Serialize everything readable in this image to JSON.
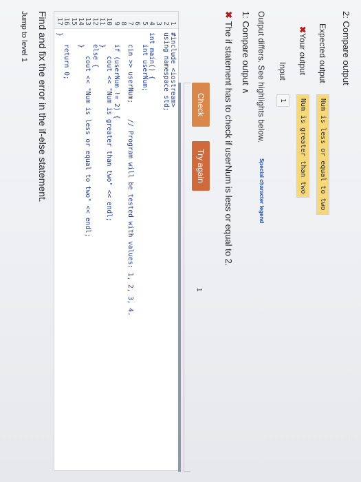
{
  "page": {
    "jump_link": "Jump to level 1",
    "instructions": "Find and fix the error in the if-else statement."
  },
  "editor": {
    "lines": [
      {
        "num": "1",
        "code": "#include <iostream>"
      },
      {
        "num": "2",
        "code": "using namespace std;"
      },
      {
        "num": "3",
        "code": ""
      },
      {
        "num": "4",
        "code": "int main() {"
      },
      {
        "num": "5",
        "code": "   int userNum;"
      },
      {
        "num": "6",
        "code": ""
      },
      {
        "num": "7",
        "code": "   cin >> userNum;    // Program will be tested with values: 1, 2, 3, 4."
      },
      {
        "num": "8",
        "code": ""
      },
      {
        "num": "9",
        "code": "   if (userNum != 2) {"
      },
      {
        "num": "10",
        "code": "      cout << \"Num is greater than two\" << endl;"
      },
      {
        "num": "11",
        "code": "   }"
      },
      {
        "num": "12",
        "code": "   else {"
      },
      {
        "num": "13",
        "code": "      cout << \"Num is less or equal to two\" << endl;"
      },
      {
        "num": "14",
        "code": "   }"
      },
      {
        "num": "15",
        "code": ""
      },
      {
        "num": "16",
        "code": "   return 0;"
      },
      {
        "num": "17",
        "code": "}"
      }
    ]
  },
  "actions": {
    "check_label": "Check",
    "try_again_label": "Try again",
    "check_count": "1"
  },
  "result": {
    "fail_icon": "✖",
    "fail_message": "The if statement has to check if userNum is less or equal to 2.",
    "compare_title": "1: Compare output ∧",
    "output_differs": "Output differs. See highlights below.",
    "legend_link": "Special character legend",
    "input_label": "Input",
    "input_value": "1",
    "your_output_label": "Your output",
    "your_output_value": "Num is greater than two",
    "expected_output_label": "Expected output",
    "expected_output_value": "Num is less or equal to two",
    "next_heading": "2: Compare output"
  }
}
